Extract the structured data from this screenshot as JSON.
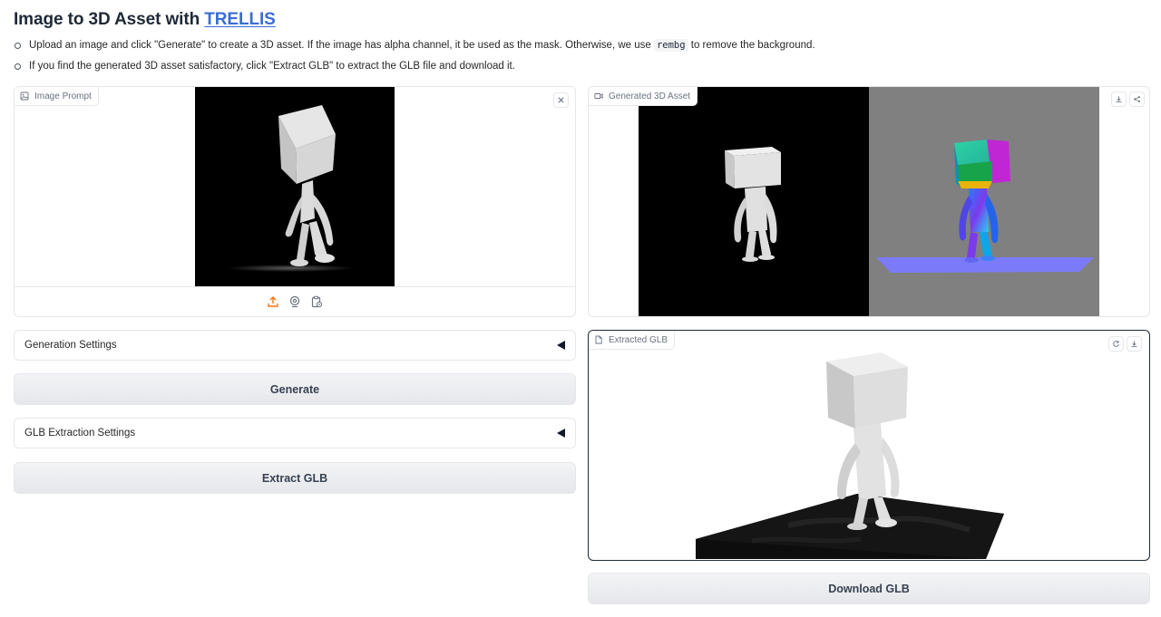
{
  "header": {
    "title_prefix": "Image to 3D Asset with ",
    "title_link": "TRELLIS"
  },
  "description": {
    "line1_a": "Upload an image and click \"Generate\" to create a 3D asset. If the image has alpha channel, it be used as the mask. Otherwise, we use ",
    "line1_code": "rembg",
    "line1_b": " to remove the background.",
    "line2": "If you find the generated 3D asset satisfactory, click \"Extract GLB\" to extract the GLB file and download it."
  },
  "image_prompt": {
    "label": "Image Prompt",
    "icon_names": [
      "image-icon",
      "close-icon",
      "upload-icon",
      "webcam-icon",
      "clipboard-icon"
    ],
    "accent_color": "#f97316"
  },
  "generated_asset": {
    "label": "Generated 3D Asset",
    "icon_names": [
      "video-icon",
      "download-icon",
      "share-icon"
    ]
  },
  "extracted_glb": {
    "label": "Extracted GLB",
    "icon_names": [
      "file-icon",
      "reset-view-icon",
      "download-icon"
    ]
  },
  "settings": {
    "generation": "Generation Settings",
    "glb_extraction": "GLB Extraction Settings"
  },
  "buttons": {
    "generate": "Generate",
    "extract_glb": "Extract GLB",
    "download_glb": "Download GLB"
  },
  "colors": {
    "link": "#3b6cd6",
    "button_bg": "#e5e7eb",
    "border": "#e5e7eb"
  }
}
